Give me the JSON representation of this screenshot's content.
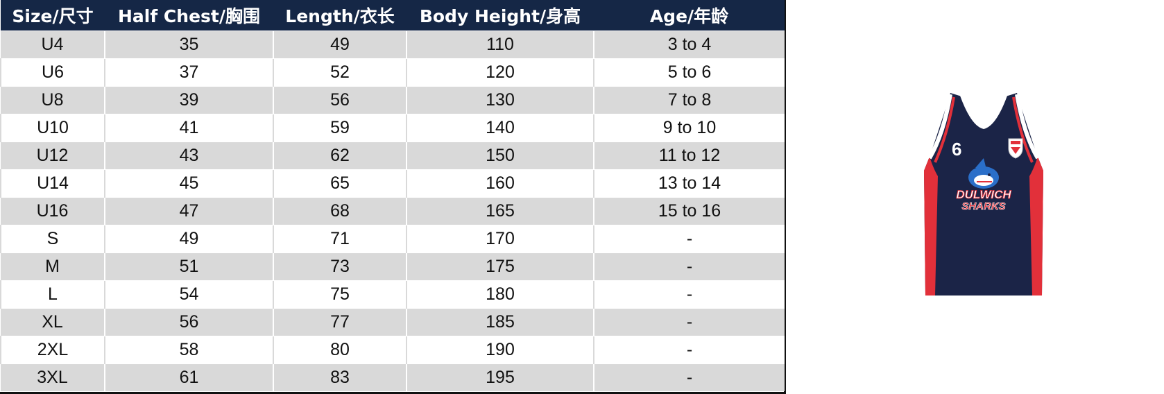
{
  "table": {
    "headers": [
      "Size/尺寸",
      "Half Chest/胸围",
      "Length/衣长",
      "Body Height/身高",
      "Age/年龄"
    ],
    "rows": [
      [
        "U4",
        "35",
        "49",
        "110",
        "3 to 4"
      ],
      [
        "U6",
        "37",
        "52",
        "120",
        "5 to 6"
      ],
      [
        "U8",
        "39",
        "56",
        "130",
        "7 to 8"
      ],
      [
        "U10",
        "41",
        "59",
        "140",
        "9 to 10"
      ],
      [
        "U12",
        "43",
        "62",
        "150",
        "11 to 12"
      ],
      [
        "U14",
        "45",
        "65",
        "160",
        "13 to 14"
      ],
      [
        "U16",
        "47",
        "68",
        "165",
        "15 to 16"
      ],
      [
        "S",
        "49",
        "71",
        "170",
        "-"
      ],
      [
        "M",
        "51",
        "73",
        "175",
        "-"
      ],
      [
        "L",
        "54",
        "75",
        "180",
        "-"
      ],
      [
        "XL",
        "56",
        "77",
        "185",
        "-"
      ],
      [
        "2XL",
        "58",
        "80",
        "190",
        "-"
      ],
      [
        "3XL",
        "61",
        "83",
        "195",
        "-"
      ]
    ]
  },
  "jersey": {
    "number": "6",
    "logo_line1": "DULWICH",
    "logo_line2": "SHARKS",
    "colors": {
      "body": "#1b2447",
      "accent": "#e2303a",
      "trim": "#ffffff"
    }
  },
  "colors": {
    "header_bg": "#152746",
    "row_shade": "#d9d9d9"
  }
}
